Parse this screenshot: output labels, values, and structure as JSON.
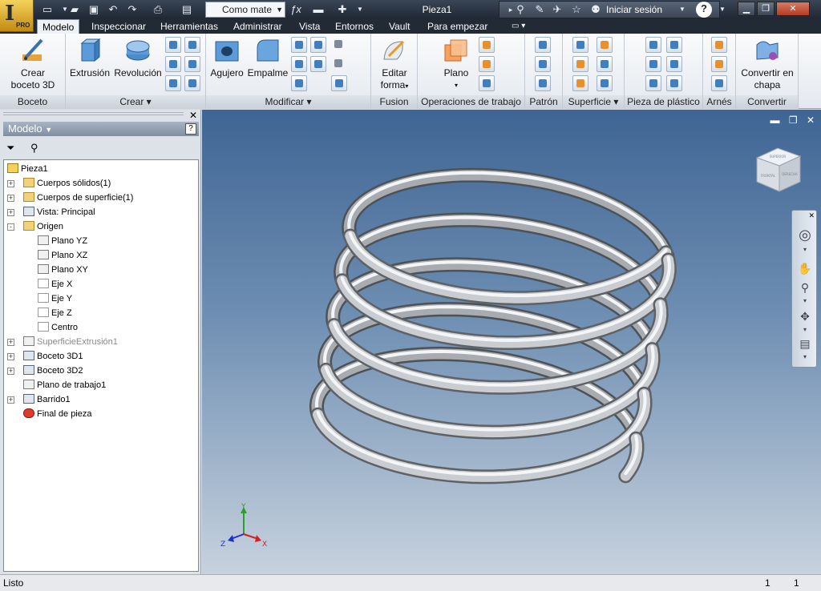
{
  "app": {
    "pro_label": "PRO",
    "document_title": "Pieza1"
  },
  "quick_access": {
    "material_value": "Como mate",
    "icons": [
      "new-icon",
      "open-icon",
      "save-icon",
      "undo-icon",
      "redo-icon",
      "print-icon",
      "select-icon",
      "fx-icon",
      "color-icon",
      "measure-icon"
    ]
  },
  "header": {
    "sign_in": "Iniciar sesión",
    "help": "?"
  },
  "tabs": [
    {
      "label": "Modelo",
      "active": true
    },
    {
      "label": "Inspeccionar"
    },
    {
      "label": "Herramientas"
    },
    {
      "label": "Administrar"
    },
    {
      "label": "Vista"
    },
    {
      "label": "Entornos"
    },
    {
      "label": "Vault"
    },
    {
      "label": "Para empezar"
    }
  ],
  "ribbon": {
    "boceto": {
      "panel_label": "Boceto",
      "create_sketch": "Crear",
      "create_sketch_2": "boceto 3D"
    },
    "crear": {
      "panel_label": "Crear",
      "extrusion": "Extrusión",
      "revolucion": "Revolución"
    },
    "modificar": {
      "panel_label": "Modificar",
      "agujero": "Agujero",
      "empalme": "Empalme"
    },
    "fusion": {
      "panel_label": "Fusion",
      "editar": "Editar",
      "forma": "forma"
    },
    "operaciones": {
      "panel_label": "Operaciones de trabajo",
      "plano": "Plano"
    },
    "patron": {
      "panel_label": "Patrón"
    },
    "superficie": {
      "panel_label": "Superficie"
    },
    "plastico": {
      "panel_label": "Pieza de plástico"
    },
    "arnes": {
      "panel_label": "Arnés"
    },
    "convertir": {
      "panel_label": "Convertir",
      "convertir_en": "Convertir en",
      "chapa": "chapa"
    }
  },
  "browser": {
    "title": "Modelo",
    "tree": [
      {
        "label": "Pieza1",
        "icon": "part",
        "level": 0,
        "expander": ""
      },
      {
        "label": "Cuerpos sólidos(1)",
        "icon": "folder",
        "level": 1,
        "expander": "+"
      },
      {
        "label": "Cuerpos de superficie(1)",
        "icon": "folder",
        "level": 1,
        "expander": "+"
      },
      {
        "label": "Vista: Principal",
        "icon": "sk",
        "level": 1,
        "expander": "+"
      },
      {
        "label": "Origen",
        "icon": "folder",
        "level": 1,
        "expander": "-"
      },
      {
        "label": "Plano YZ",
        "icon": "plane",
        "level": 2,
        "expander": ""
      },
      {
        "label": "Plano XZ",
        "icon": "plane",
        "level": 2,
        "expander": ""
      },
      {
        "label": "Plano XY",
        "icon": "plane",
        "level": 2,
        "expander": ""
      },
      {
        "label": "Eje X",
        "icon": "axis",
        "level": 2,
        "expander": ""
      },
      {
        "label": "Eje Y",
        "icon": "axis",
        "level": 2,
        "expander": ""
      },
      {
        "label": "Eje Z",
        "icon": "axis",
        "level": 2,
        "expander": ""
      },
      {
        "label": "Centro",
        "icon": "axis",
        "level": 2,
        "expander": ""
      },
      {
        "label": "SuperficieExtrusión1",
        "icon": "plane",
        "level": 1,
        "expander": "+",
        "gray": true
      },
      {
        "label": "Boceto 3D1",
        "icon": "sk",
        "level": 1,
        "expander": "+"
      },
      {
        "label": "Boceto 3D2",
        "icon": "sk",
        "level": 1,
        "expander": "+"
      },
      {
        "label": "Plano de trabajo1",
        "icon": "plane",
        "level": 1,
        "expander": ""
      },
      {
        "label": "Barrido1",
        "icon": "sk",
        "level": 1,
        "expander": "+"
      },
      {
        "label": "Final de pieza",
        "icon": "red",
        "level": 1,
        "expander": ""
      }
    ]
  },
  "viewcube": {
    "top": "SUPERIOR",
    "front": "FRONTAL",
    "right": "DERECHA"
  },
  "axes": {
    "x": "X",
    "y": "Y",
    "z": "Z"
  },
  "status": {
    "text": "Listo",
    "count1": "1",
    "count2": "1"
  }
}
